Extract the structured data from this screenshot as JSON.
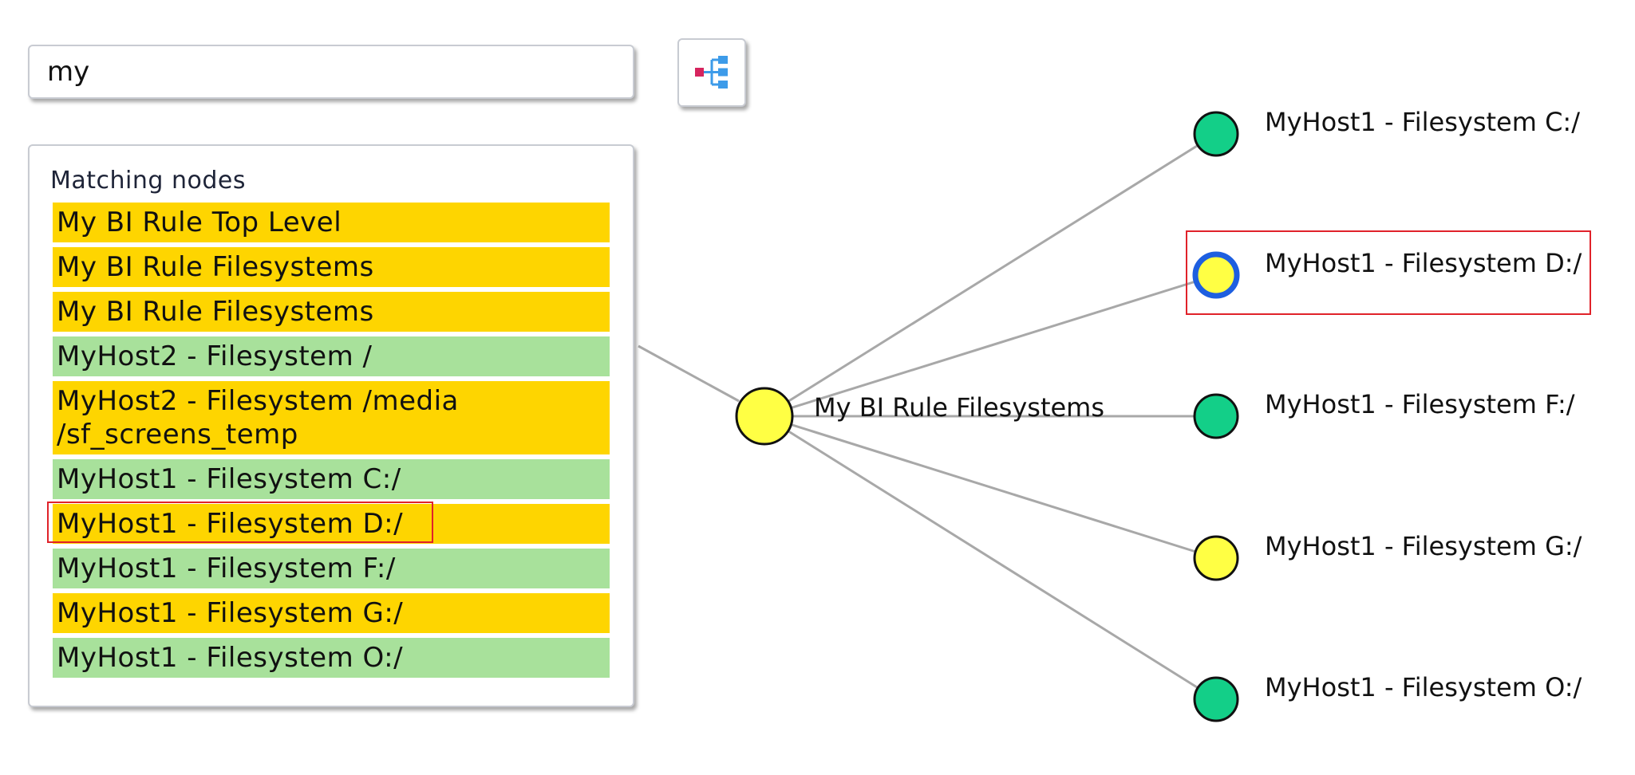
{
  "search": {
    "value": "my"
  },
  "layout_button": {
    "icon": "tree-layout-icon"
  },
  "panel": {
    "title": "Matching nodes",
    "items": [
      {
        "label": "My BI Rule Top Level",
        "state": "warn"
      },
      {
        "label": "My BI Rule Filesystems",
        "state": "warn"
      },
      {
        "label": "My BI Rule Filesystems",
        "state": "warn"
      },
      {
        "label": "MyHost2 - Filesystem /",
        "state": "ok"
      },
      {
        "label": "MyHost2 - Filesystem /media /sf_screens_temp",
        "state": "warn"
      },
      {
        "label": "MyHost1 - Filesystem C:/",
        "state": "ok"
      },
      {
        "label": "MyHost1 - Filesystem D:/",
        "state": "warn",
        "highlighted": true
      },
      {
        "label": "MyHost1 - Filesystem F:/",
        "state": "ok"
      },
      {
        "label": "MyHost1 - Filesystem G:/",
        "state": "warn"
      },
      {
        "label": "MyHost1 - Filesystem O:/",
        "state": "ok"
      }
    ]
  },
  "graph": {
    "root": {
      "label": "My BI Rule Filesystems",
      "state": "warn"
    },
    "children": [
      {
        "label": "MyHost1 - Filesystem C:/",
        "state": "ok"
      },
      {
        "label": "MyHost1 - Filesystem D:/",
        "state": "warn",
        "selected": true
      },
      {
        "label": "MyHost1 - Filesystem F:/",
        "state": "ok"
      },
      {
        "label": "MyHost1 - Filesystem G:/",
        "state": "warn"
      },
      {
        "label": "MyHost1 - Filesystem O:/",
        "state": "ok"
      }
    ]
  },
  "colors": {
    "ok_row": "#a8e19b",
    "warn_row": "#fed500",
    "ok_node": "#13cf88",
    "warn_node": "#ffff44",
    "selected_ring": "#1e5fe0",
    "highlight_border": "#e0222a",
    "edge": "#a8a8a8"
  }
}
